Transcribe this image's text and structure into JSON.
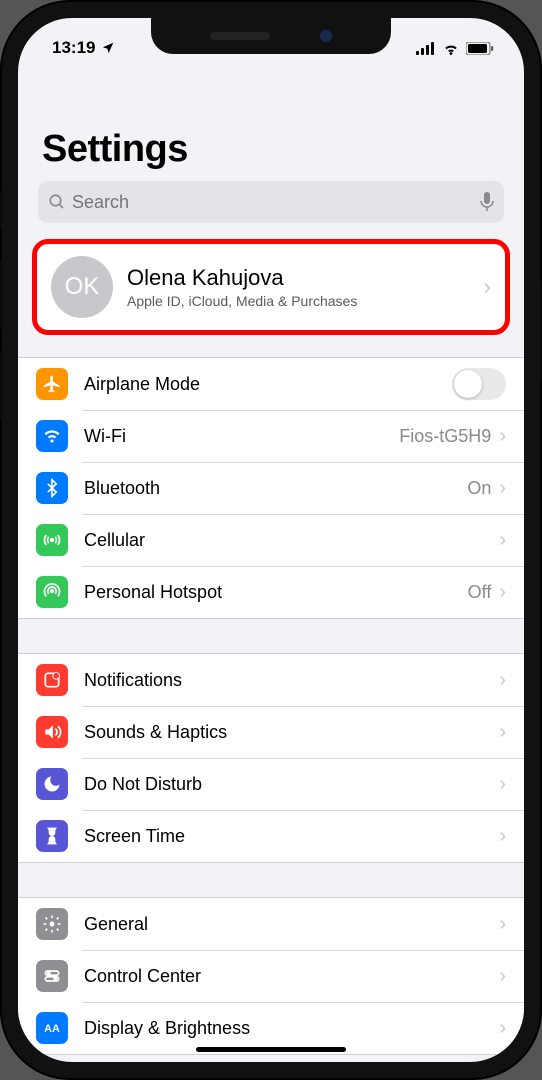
{
  "statusbar": {
    "time": "13:19"
  },
  "title": "Settings",
  "search": {
    "placeholder": "Search"
  },
  "profile": {
    "initials": "OK",
    "name": "Olena Kahujova",
    "subtitle": "Apple ID, iCloud, Media & Purchases"
  },
  "groups": [
    {
      "rows": [
        {
          "icon": "airplane",
          "bg": "bg-orange",
          "label": "Airplane Mode",
          "type": "toggle",
          "on": false
        },
        {
          "icon": "wifi",
          "bg": "bg-blue",
          "label": "Wi-Fi",
          "type": "link",
          "value": "Fios-tG5H9"
        },
        {
          "icon": "bluetooth",
          "bg": "bg-blue",
          "label": "Bluetooth",
          "type": "link",
          "value": "On"
        },
        {
          "icon": "cellular",
          "bg": "bg-green",
          "label": "Cellular",
          "type": "link",
          "value": ""
        },
        {
          "icon": "hotspot",
          "bg": "bg-green",
          "label": "Personal Hotspot",
          "type": "link",
          "value": "Off"
        }
      ]
    },
    {
      "rows": [
        {
          "icon": "notifications",
          "bg": "bg-red",
          "label": "Notifications",
          "type": "link",
          "value": ""
        },
        {
          "icon": "sounds",
          "bg": "bg-red",
          "label": "Sounds & Haptics",
          "type": "link",
          "value": ""
        },
        {
          "icon": "dnd",
          "bg": "bg-purple",
          "label": "Do Not Disturb",
          "type": "link",
          "value": ""
        },
        {
          "icon": "screentime",
          "bg": "bg-purple",
          "label": "Screen Time",
          "type": "link",
          "value": ""
        }
      ]
    },
    {
      "rows": [
        {
          "icon": "general",
          "bg": "bg-gray",
          "label": "General",
          "type": "link",
          "value": ""
        },
        {
          "icon": "controlcenter",
          "bg": "bg-gray",
          "label": "Control Center",
          "type": "link",
          "value": ""
        },
        {
          "icon": "display",
          "bg": "bg-blue",
          "label": "Display & Brightness",
          "type": "link",
          "value": ""
        }
      ]
    }
  ]
}
